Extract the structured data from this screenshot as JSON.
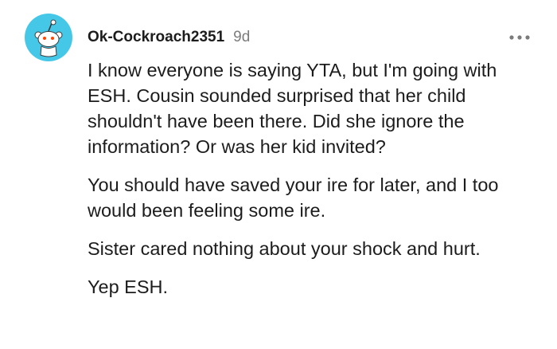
{
  "comment": {
    "avatar_icon": "reddit-snoo-avatar-icon",
    "avatar_bg": "#45c8e8",
    "username": "Ok-Cockroach2351",
    "age": "9d",
    "more_icon": "more-options-icon",
    "paragraphs": [
      "I know everyone is saying YTA, but I'm going with ESH. Cousin sounded surprised that her child shouldn't have been there. Did she ignore the information? Or was her kid invited?",
      "You should have saved your ire for later, and I too would been feeling some ire.",
      "Sister cared nothing about your shock and hurt.",
      "Yep ESH."
    ]
  }
}
